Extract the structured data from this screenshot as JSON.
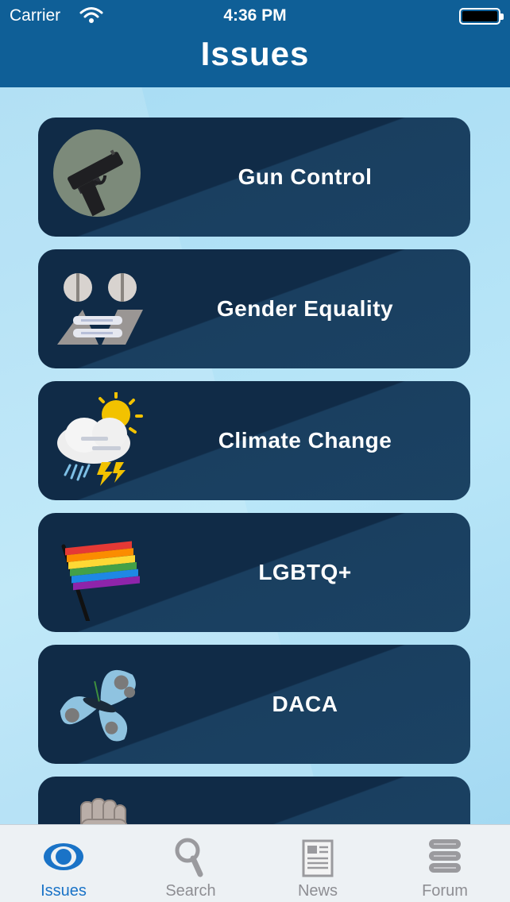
{
  "status_bar": {
    "carrier": "Carrier",
    "time": "4:36 PM"
  },
  "header": {
    "title": "Issues"
  },
  "issues": [
    {
      "label": "Gun Control",
      "icon": "pistol-icon"
    },
    {
      "label": "Gender Equality",
      "icon": "gender-equality-icon"
    },
    {
      "label": "Climate Change",
      "icon": "weather-storm-icon"
    },
    {
      "label": "LGBTQ+",
      "icon": "rainbow-flag-icon"
    },
    {
      "label": "DACA",
      "icon": "butterfly-icon"
    },
    {
      "label": "",
      "icon": "raised-fist-icon"
    }
  ],
  "tab_bar": {
    "tabs": [
      {
        "label": "Issues",
        "icon": "eye-icon",
        "active": true
      },
      {
        "label": "Search",
        "icon": "magnifier-icon",
        "active": false
      },
      {
        "label": "News",
        "icon": "newspaper-icon",
        "active": false
      },
      {
        "label": "Forum",
        "icon": "chat-stack-icon",
        "active": false
      }
    ]
  },
  "colors": {
    "header": "#0f5f97",
    "background": "#a8dcf3",
    "card": "#102b47",
    "tab_active": "#1a73c7",
    "tab_inactive": "#8e8e93"
  }
}
